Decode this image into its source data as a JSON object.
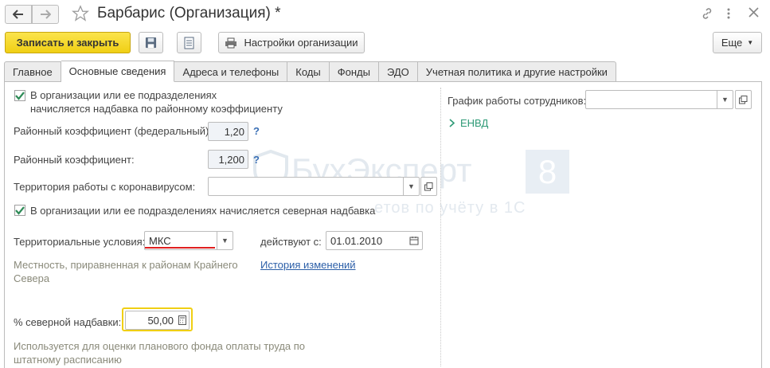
{
  "window": {
    "title": "Барбарис (Организация) *"
  },
  "toolbar": {
    "save_close_label": "Записать и закрыть",
    "settings_label": "Настройки организации",
    "more_label": "Еще"
  },
  "tabs": [
    {
      "label": "Главное",
      "active": false
    },
    {
      "label": "Основные сведения",
      "active": true
    },
    {
      "label": "Адреса и телефоны",
      "active": false
    },
    {
      "label": "Коды",
      "active": false
    },
    {
      "label": "Фонды",
      "active": false
    },
    {
      "label": "ЭДО",
      "active": false
    },
    {
      "label": "Учетная политика и другие настройки",
      "active": false
    }
  ],
  "form": {
    "district_coef_checkbox": {
      "label_line1": "В организации или ее подразделениях",
      "label_line2": "начисляется надбавка по районному коэффициенту",
      "checked": true
    },
    "federal_coef": {
      "label": "Районный коэффициент (федеральный):",
      "value": "1,20",
      "help": "?"
    },
    "district_coef": {
      "label": "Районный коэффициент:",
      "value": "1,200",
      "help": "?"
    },
    "coronavirus_territory": {
      "label": "Территория работы с коронавирусом:",
      "value": ""
    },
    "north_checkbox": {
      "label": "В организации или ее подразделениях начисляется северная надбавка",
      "checked": true
    },
    "territorial_conditions": {
      "label": "Территориальные условия:",
      "value": "МКС"
    },
    "valid_from": {
      "label": "действуют с:",
      "value": "01.01.2010"
    },
    "territory_hint_line1": "Местность, приравненная к районам Крайнего",
    "territory_hint_line2": "Севера",
    "history_link": "История изменений",
    "north_percent": {
      "label": "% северной надбавки:",
      "value": "50,00"
    },
    "fund_hint_line1": "Используется для оценки планового фонда оплаты труда по",
    "fund_hint_line2": "штатному расписанию",
    "schedule": {
      "label": "График работы сотрудников:",
      "value": ""
    },
    "envd_label": "ЕНВД"
  },
  "watermark": {
    "brand": "БухЭксперт",
    "digit": "8",
    "tagline": "етов по учёту в 1С"
  },
  "colors": {
    "primary_button": "#f0cf14",
    "link": "#2c5fa8",
    "green_group": "#2e9a76",
    "highlight_border": "#f0cf14",
    "error_underline": "#e02020"
  }
}
